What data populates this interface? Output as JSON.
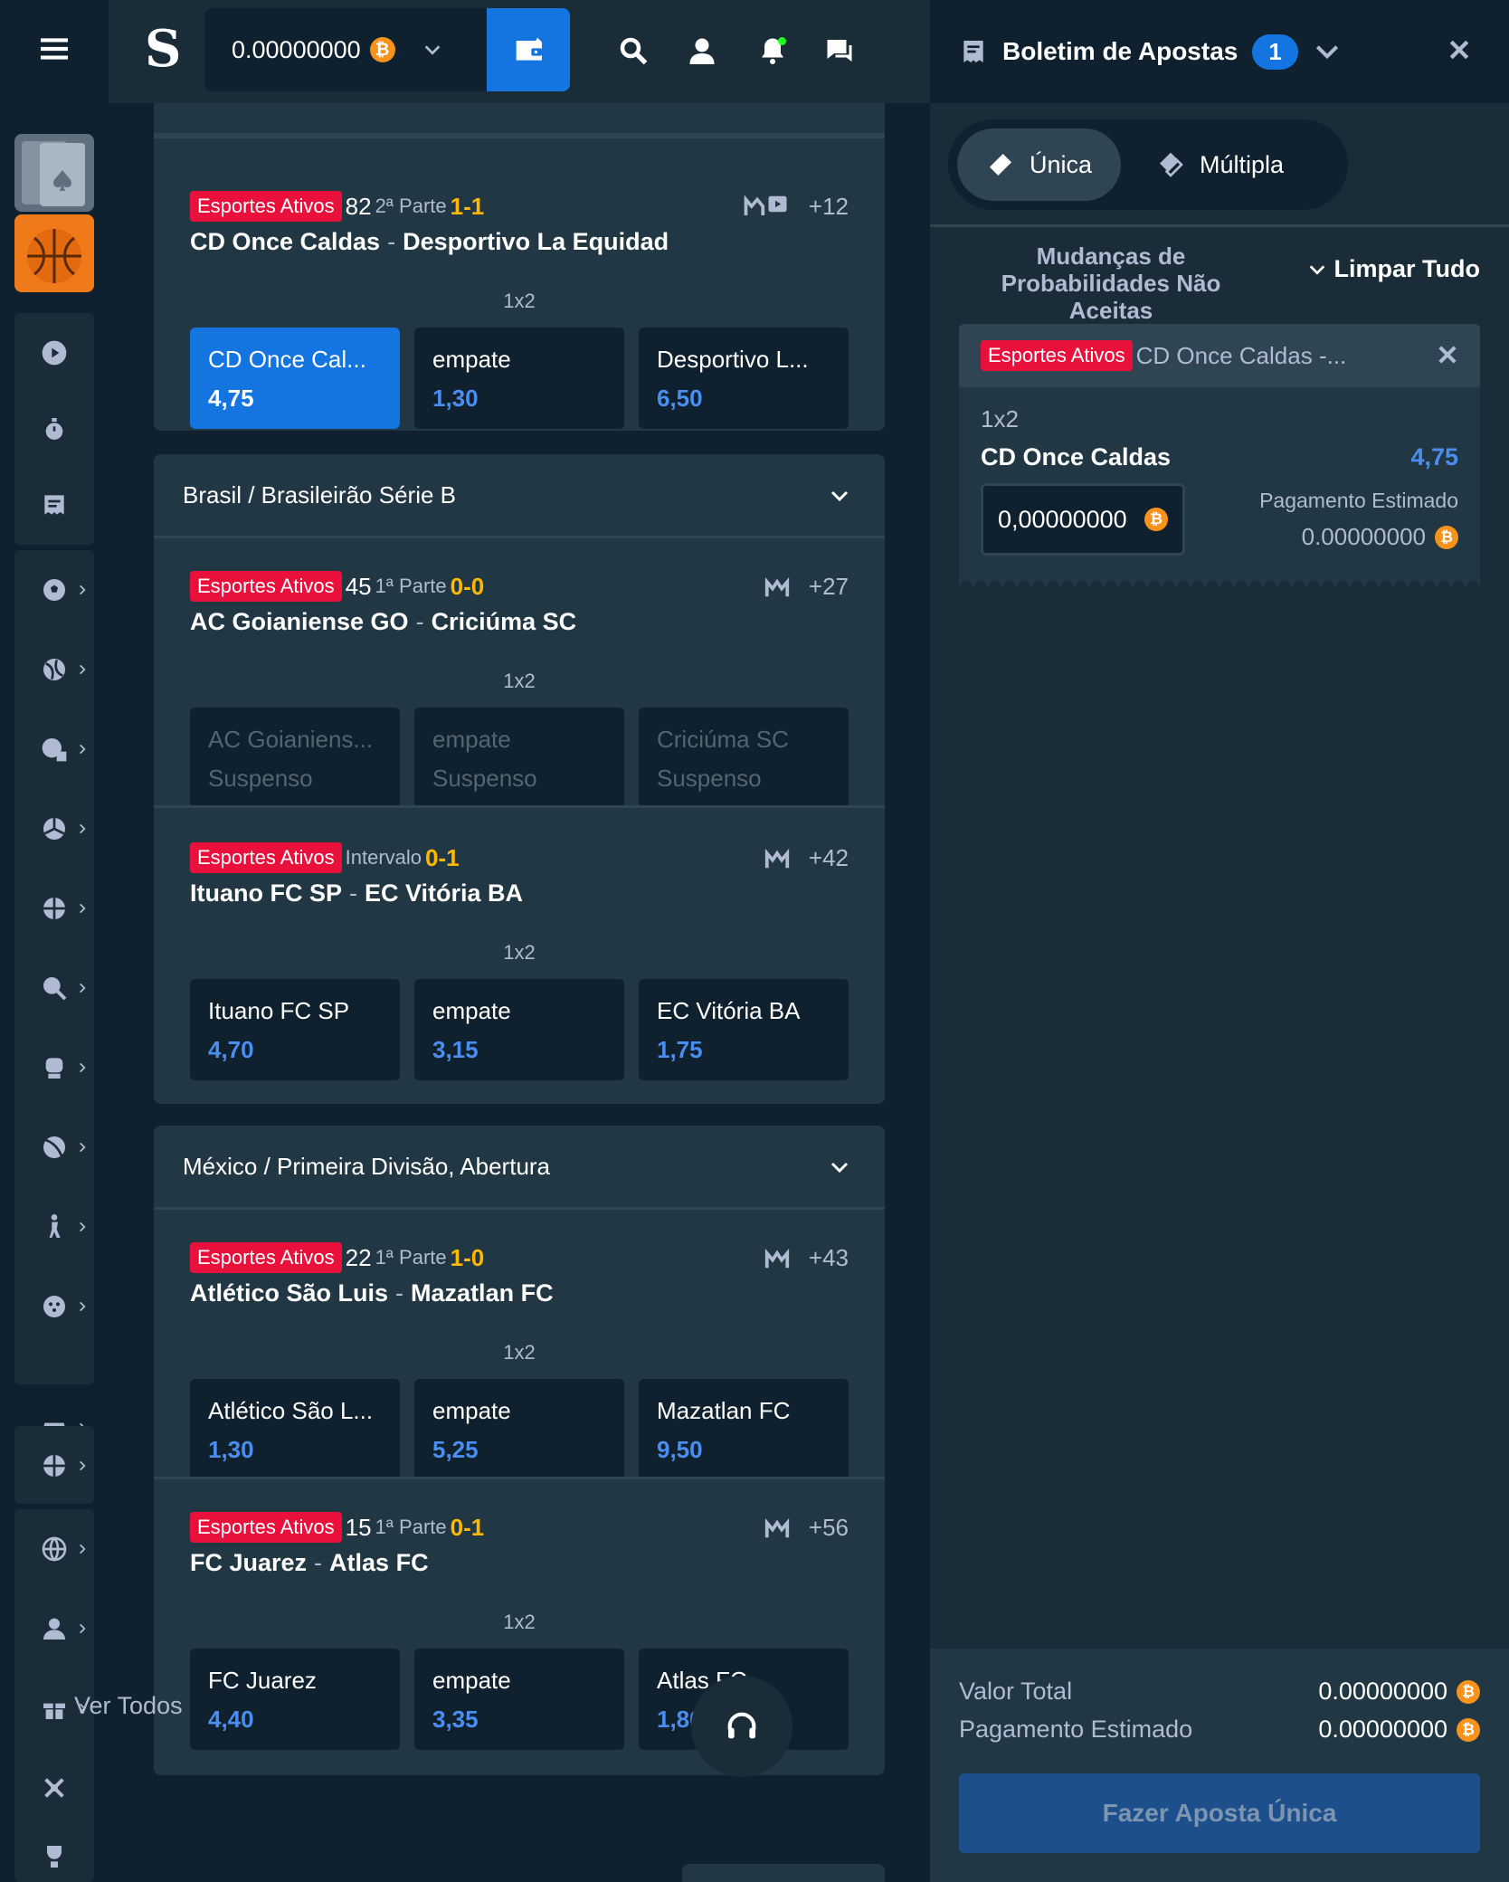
{
  "wallet": {
    "balance": "0.00000000"
  },
  "matches_top": {
    "m1": {
      "live": "Esportes Ativos",
      "clock": "82",
      "period": "2ª Parte",
      "score": "1-1",
      "more": "+12",
      "home": "CD Once Caldas",
      "sep": "-",
      "away": "Desportivo La Equidad",
      "market": "1x2",
      "odds": [
        {
          "name": "CD Once Cal...",
          "value": "4,75"
        },
        {
          "name": "empate",
          "value": "1,30"
        },
        {
          "name": "Desportivo L...",
          "value": "6,50"
        }
      ]
    }
  },
  "league_b": {
    "title": "Brasil / Brasileirão Série B",
    "m1": {
      "live": "Esportes Ativos",
      "clock": "45",
      "period": "1ª Parte",
      "score": "0-0",
      "more": "+27",
      "home": "AC Goianiense GO",
      "sep": "-",
      "away": "Criciúma SC",
      "market": "1x2",
      "odds": [
        {
          "name": "AC Goianiens...",
          "value": "Suspenso"
        },
        {
          "name": "empate",
          "value": "Suspenso"
        },
        {
          "name": "Criciúma SC",
          "value": "Suspenso"
        }
      ]
    },
    "m2": {
      "live": "Esportes Ativos",
      "clock": "",
      "period": "Intervalo",
      "score": "0-1",
      "more": "+42",
      "home": "Ituano FC SP",
      "sep": "-",
      "away": "EC Vitória BA",
      "market": "1x2",
      "odds": [
        {
          "name": "Ituano FC SP",
          "value": "4,70"
        },
        {
          "name": "empate",
          "value": "3,15"
        },
        {
          "name": "EC Vitória BA",
          "value": "1,75"
        }
      ]
    }
  },
  "league_mx": {
    "title": "México / Primeira Divisão, Abertura",
    "m1": {
      "live": "Esportes Ativos",
      "clock": "22",
      "period": "1ª Parte",
      "score": "1-0",
      "more": "+43",
      "home": "Atlético São Luis",
      "sep": "-",
      "away": "Mazatlan FC",
      "market": "1x2",
      "odds": [
        {
          "name": "Atlético São L...",
          "value": "1,30"
        },
        {
          "name": "empate",
          "value": "5,25"
        },
        {
          "name": "Mazatlan FC",
          "value": "9,50"
        }
      ]
    },
    "m2": {
      "live": "Esportes Ativos",
      "clock": "15",
      "period": "1ª Parte",
      "score": "0-1",
      "more": "+56",
      "home": "FC Juarez",
      "sep": "-",
      "away": "Atlas FC",
      "market": "1x2",
      "odds": [
        {
          "name": "FC Juarez",
          "value": "4,40"
        },
        {
          "name": "empate",
          "value": "3,35"
        },
        {
          "name": "Atlas FC",
          "value": "1,80"
        }
      ]
    }
  },
  "view_all": "Ver Todos",
  "betslip": {
    "title": "Boletim de Apostas",
    "count": "1",
    "tab_single": "Única",
    "tab_multi": "Múltipla",
    "odds_change": "Mudanças de Probabilidades Não Aceitas",
    "clear_all": "Limpar Tudo",
    "bet": {
      "live": "Esportes Ativos",
      "title": "CD Once Caldas -...",
      "market": "1x2",
      "selection": "CD Once Caldas",
      "odd": "4,75",
      "stake": "0,00000000",
      "est_label": "Pagamento Estimado",
      "est_value": "0.00000000"
    },
    "total_label": "Valor Total",
    "total_value": "0.00000000",
    "payout_label": "Pagamento Estimado",
    "payout_value": "0.00000000",
    "place": "Fazer Aposta Única"
  },
  "currency_symbol": "₿",
  "colors": {
    "accent": "#1475e1",
    "live": "#e9113c",
    "score": "#ffb800",
    "odd": "#4b8ef1"
  }
}
